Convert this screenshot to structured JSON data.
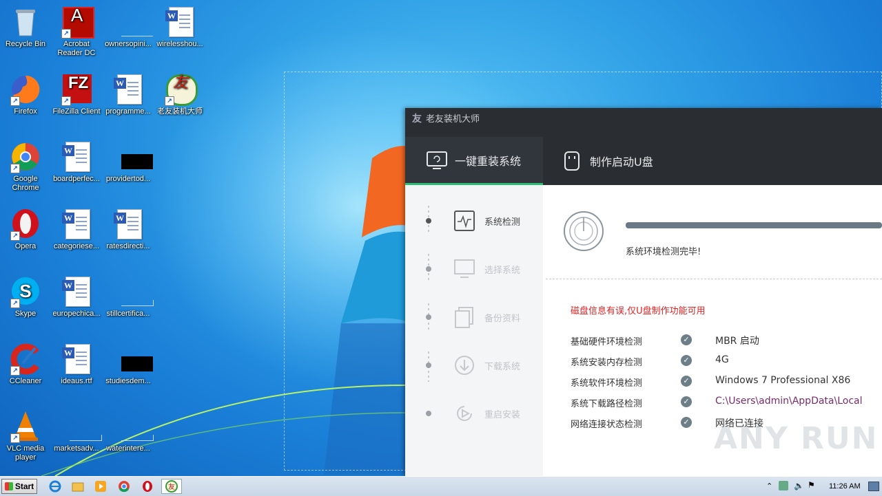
{
  "desktop": {
    "icons": [
      {
        "id": "recycle-bin",
        "label": "Recycle Bin"
      },
      {
        "id": "acrobat",
        "label": "Acrobat Reader DC"
      },
      {
        "id": "ownersopini",
        "label": "ownersopini..."
      },
      {
        "id": "wirelesshou",
        "label": "wirelesshou..."
      },
      {
        "id": "firefox",
        "label": "Firefox"
      },
      {
        "id": "filezilla",
        "label": "FileZilla Client"
      },
      {
        "id": "programme",
        "label": "programme..."
      },
      {
        "id": "laoyou",
        "label": "老友装机大师"
      },
      {
        "id": "chrome",
        "label": "Google Chrome"
      },
      {
        "id": "boardperfec",
        "label": "boardperfec..."
      },
      {
        "id": "providertod",
        "label": "providertod..."
      },
      {
        "id": "opera",
        "label": "Opera"
      },
      {
        "id": "categoriese",
        "label": "categoriese..."
      },
      {
        "id": "ratesdirecti",
        "label": "ratesdirecti..."
      },
      {
        "id": "skype",
        "label": "Skype"
      },
      {
        "id": "europechica",
        "label": "europechica..."
      },
      {
        "id": "stillcertifica",
        "label": "stillcertifica..."
      },
      {
        "id": "ccleaner",
        "label": "CCleaner"
      },
      {
        "id": "ideaus",
        "label": "ideaus.rtf"
      },
      {
        "id": "studiesdem",
        "label": "studiesdem..."
      },
      {
        "id": "vlc",
        "label": "VLC media player"
      },
      {
        "id": "marketsadv",
        "label": "marketsadv..."
      },
      {
        "id": "waterintere",
        "label": "waterintere..."
      }
    ]
  },
  "app": {
    "title": "老友装机大师",
    "tabs": [
      "一键重装系统",
      "制作启动U盘"
    ],
    "steps": [
      "系统检测",
      "选择系统",
      "备份资料",
      "下载系统",
      "重启安装"
    ],
    "status": "系统环境检测完毕!",
    "error": "磁盘信息有误,仅U盘制作功能可用",
    "checks": [
      {
        "key": "基础硬件环境检测",
        "value": "MBR 启动"
      },
      {
        "key": "系统安装内存检测",
        "value": "4G"
      },
      {
        "key": "系统软件环境检测",
        "value": "Windows 7 Professional X86"
      },
      {
        "key": "系统下载路径检测",
        "value": "C:\\Users\\admin\\AppData\\Local"
      },
      {
        "key": "网络连接状态检测",
        "value": "网络已连接"
      }
    ],
    "progress": 1.0
  },
  "watermark": "ANY RUN",
  "taskbar": {
    "start_label": "Start",
    "clock": "11:26 AM"
  },
  "colors": {
    "accent_green": "#2fbf74",
    "titlebar": "#2a2e33",
    "error_red": "#e02020"
  }
}
